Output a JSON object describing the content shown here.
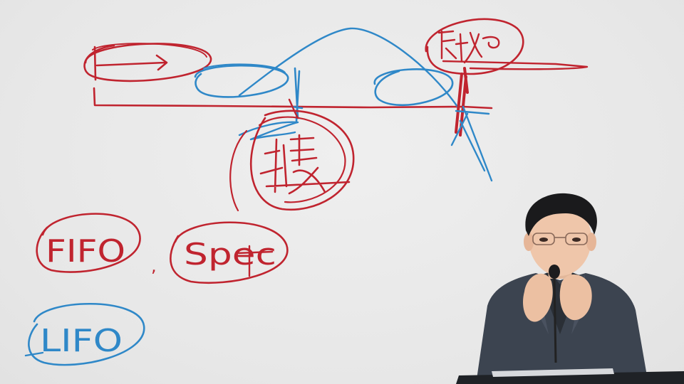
{
  "board": {
    "words": {
      "fifo": "FIFO",
      "specific": "Spec",
      "lifo": "LIFO"
    },
    "separator": ","
  },
  "colors": {
    "background": "#e9e9e9",
    "red_ink": "#c0242f",
    "blue_ink": "#2f88c8"
  }
}
